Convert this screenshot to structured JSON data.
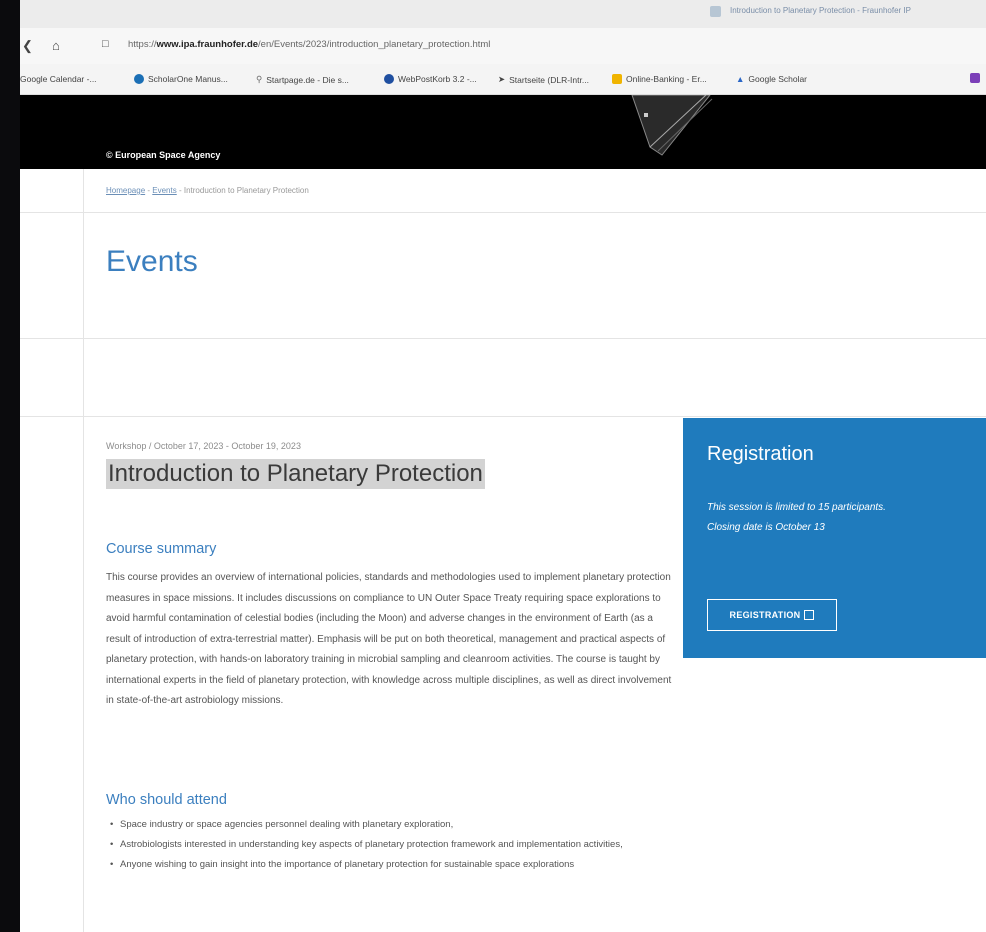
{
  "browser": {
    "tab_title": "Introduction to Planetary Protection - Fraunhofer IP",
    "url_prefix": "https://",
    "url_domain": "www.ipa.fraunhofer.de",
    "url_path": "/en/Events/2023/introduction_planetary_protection.html",
    "bookmarks": [
      {
        "label": "Google Calendar -...",
        "icon": "calendar-icon",
        "color": "#ffffff"
      },
      {
        "label": "ScholarOne Manus...",
        "icon": "scholarone-icon",
        "color": "#1b6fb5"
      },
      {
        "label": "Startpage.de - Die s...",
        "icon": "search-icon",
        "color": "#666666"
      },
      {
        "label": "WebPostKorb 3.2 -...",
        "icon": "mail-icon",
        "color": "#1f4fa0"
      },
      {
        "label": "Startseite (DLR-Intr...",
        "icon": "dlr-icon",
        "color": "#444444"
      },
      {
        "label": "Online-Banking - Er...",
        "icon": "bank-icon",
        "color": "#f0b400"
      },
      {
        "label": "Google Scholar",
        "icon": "scholar-icon",
        "color": "#2a66c6"
      }
    ]
  },
  "banner": {
    "credit": "© European Space Agency"
  },
  "breadcrumb": {
    "home": "Homepage",
    "events": "Events",
    "current": "Introduction to Planetary Protection"
  },
  "page": {
    "section_title": "Events"
  },
  "article": {
    "meta": "Workshop / October 17, 2023 - October 19, 2023",
    "title": "Introduction to Planetary Protection",
    "summary_heading": "Course summary",
    "summary_text": "This course provides an overview of international policies, standards and methodologies used to implement planetary protection measures in space missions. It includes discussions on compliance to UN Outer Space Treaty requiring space explorations to avoid harmful contamination of celestial bodies (including the Moon) and adverse changes in the environment of Earth (as a result of introduction of extra-terrestrial matter). Emphasis will be put on both theoretical, management and practical aspects of planetary protection, with hands-on laboratory training in microbial sampling and cleanroom activities. The course is taught by international experts in the field of planetary protection, with knowledge across multiple disciplines, as well as direct involvement in state-of-the-art astrobiology missions.",
    "attend_heading": "Who should attend",
    "attend_items": [
      "Space industry or space agencies personnel dealing with planetary exploration,",
      "Astrobiologists interested in understanding key aspects of planetary protection framework and implementation activities,",
      "Anyone wishing to gain insight into the importance of planetary protection for sustainable space explorations"
    ]
  },
  "registration": {
    "title": "Registration",
    "note_line1": "This session is limited to 15 participants.",
    "note_line2": "Closing date is October 13",
    "button_label": "REGISTRATION",
    "accent_color": "#1f7bbd"
  }
}
